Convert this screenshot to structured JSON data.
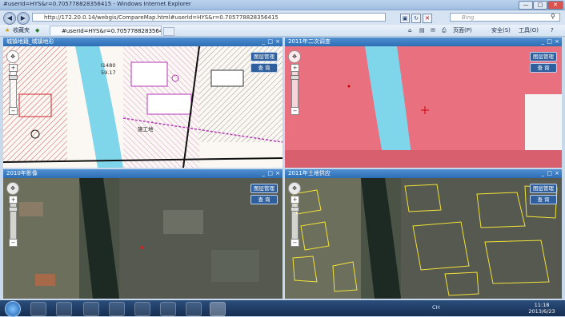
{
  "window": {
    "title": "#userId=HYS&r=0.705778828356415 - Windows Internet Explorer",
    "minimize": "—",
    "maximize": "□",
    "close": "✕"
  },
  "addressbar": {
    "back": "◀",
    "forward": "▶",
    "url": "http://172.20.0.14/webgis/CompareMap.html#userId=HYS&r=0.705778828356415",
    "refresh": "↻",
    "stop": "✕",
    "search_placeholder": "Bing"
  },
  "commandbar": {
    "favorites": "收藏夹",
    "tab_title": "#userId=HYS&r=0.705778828356415",
    "page_menu": "页面(P)",
    "safety_menu": "安全(S)",
    "tools_menu": "工具(O)",
    "help_menu": "?"
  },
  "panels": [
    {
      "title": "城镇地籍_城镇地形",
      "layer_btn": "图层管理",
      "query_btn": "查 询"
    },
    {
      "title": "2011年二次调查",
      "layer_btn": "图层管理",
      "query_btn": "查 询"
    },
    {
      "title": "2010年影像",
      "layer_btn": "图层管理",
      "query_btn": "查 询"
    },
    {
      "title": "2011年土地供应",
      "layer_btn": "图层管理",
      "query_btn": "查 询"
    }
  ],
  "panel_controls": {
    "min": "_",
    "max": "□",
    "close": "×"
  },
  "map_labels": {
    "cad_value_1": "I1480",
    "cad_value_2": "59.17",
    "cad_label_construction": "施工地"
  },
  "colors": {
    "header_blue": "#2d6db4",
    "survey_pink": "#e8707f",
    "river_cyan": "#7fd6ea",
    "cad_red": "#c8242a",
    "supply_yellow": "#f2e23a"
  },
  "taskbar": {
    "tray_text": "CH",
    "time": "11:18",
    "date": "2013/6/23"
  }
}
